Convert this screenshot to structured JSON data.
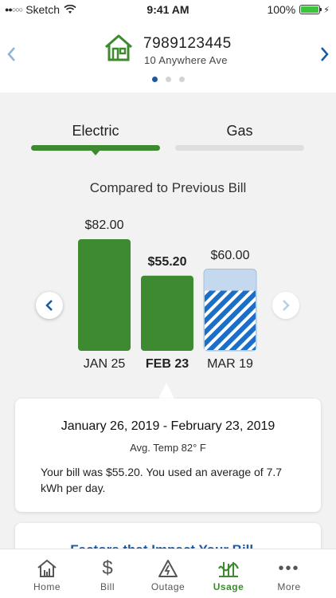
{
  "status_bar": {
    "carrier": "Sketch",
    "time": "9:41 AM",
    "battery": "100%"
  },
  "account": {
    "number": "7989123445",
    "address": "10 Anywhere Ave",
    "page_count": 3,
    "active_page": 1
  },
  "tabs": [
    {
      "label": "Electric",
      "selected": true
    },
    {
      "label": "Gas",
      "selected": false
    }
  ],
  "comparison_title": "Compared to Previous Bill",
  "chart_data": {
    "type": "bar",
    "categories": [
      "JAN 25",
      "FEB 23",
      "MAR 19"
    ],
    "values": [
      82.0,
      55.2,
      60.0
    ],
    "value_labels": [
      "$82.00",
      "$55.20",
      "$60.00"
    ],
    "selected_index": 1,
    "projected_index": 2,
    "colors": {
      "actual": "#3d8a31",
      "projected_fill": "#1b6fc7",
      "projected_light": "#c5d9ee"
    }
  },
  "detail": {
    "date_range": "January 26, 2019 - February 23, 2019",
    "avg_temp": "Avg. Temp 82° F",
    "summary": "Your bill was $55.20. You used an average of 7.7 kWh per day."
  },
  "factors": {
    "title": "Factors that Impact Your Bill"
  },
  "bottom_tabs": [
    {
      "label": "Home",
      "icon": "home-icon",
      "active": false
    },
    {
      "label": "Bill",
      "icon": "dollar-icon",
      "active": false
    },
    {
      "label": "Outage",
      "icon": "outage-icon",
      "active": false
    },
    {
      "label": "Usage",
      "icon": "usage-icon",
      "active": true
    },
    {
      "label": "More",
      "icon": "more-icon",
      "active": false
    }
  ]
}
